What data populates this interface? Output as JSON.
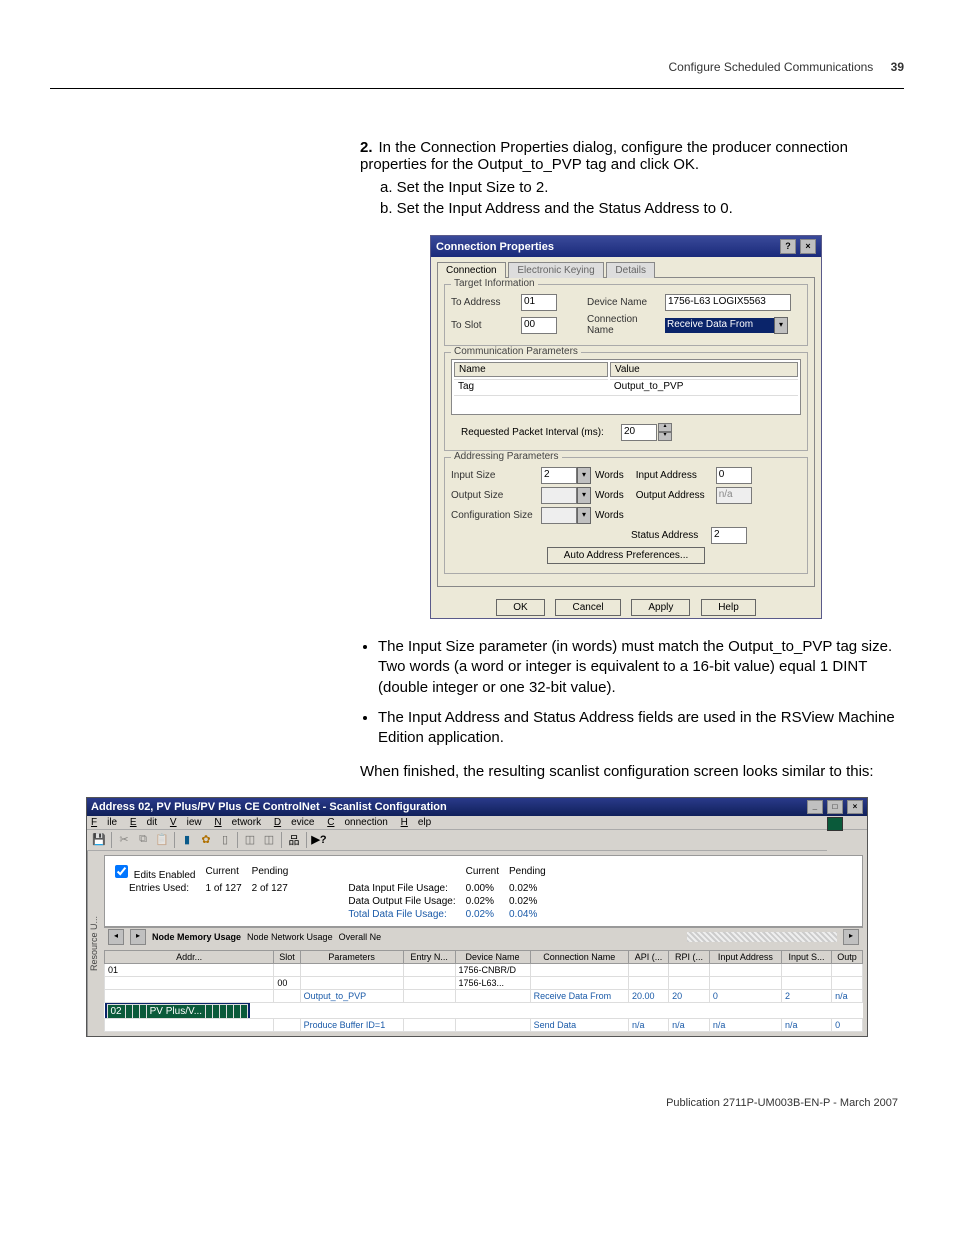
{
  "header": {
    "section": "Configure Scheduled Communications",
    "page": "39"
  },
  "step": {
    "num": "2.",
    "text": "In the Connection Properties dialog, configure the producer connection properties for the Output_to_PVP tag and click OK.",
    "a": "a. Set the Input Size to 2.",
    "b": "b. Set the Input Address and the Status Address to 0."
  },
  "dialog": {
    "title": "Connection Properties",
    "tabs": {
      "t1": "Connection",
      "t2": "Electronic Keying",
      "t3": "Details"
    },
    "group_target": "Target Information",
    "to_addr_lbl": "To Address",
    "to_addr": "01",
    "to_slot_lbl": "To Slot",
    "to_slot": "00",
    "dev_lbl": "Device Name",
    "dev": "1756-L63 LOGIX5563",
    "conn_lbl": "Connection Name",
    "conn": "Receive Data From",
    "group_comm": "Communication Parameters",
    "th_name": "Name",
    "th_val": "Value",
    "row_name": "Tag",
    "row_val": "Output_to_PVP",
    "rpi_lbl": "Requested Packet Interval (ms):",
    "rpi": "20",
    "group_addr": "Addressing Parameters",
    "in_size_lbl": "Input Size",
    "in_size": "2",
    "words": "Words",
    "in_addr_lbl": "Input Address",
    "in_addr": "0",
    "out_size_lbl": "Output Size",
    "out_addr_lbl": "Output Address",
    "out_addr": "n/a",
    "cfg_lbl": "Configuration Size",
    "stat_lbl": "Status Address",
    "stat": "2",
    "auto_btn": "Auto Address Preferences...",
    "ok": "OK",
    "cancel": "Cancel",
    "apply": "Apply",
    "help": "Help"
  },
  "bullets": {
    "b1": "The Input Size parameter (in words) must match the Output_to_PVP tag size. Two words (a word or integer is equivalent to a 16-bit value) equal 1 DINT (double integer or one 32-bit value).",
    "b2": "The Input Address and Status Address fields are used in the RSView Machine Edition application."
  },
  "para_after": "When finished, the resulting scanlist configuration screen looks similar to this:",
  "scanlist": {
    "title": "Address 02, PV Plus/PV Plus CE ControlNet - Scanlist Configuration",
    "menu": {
      "file": "File",
      "edit": "Edit",
      "view": "View",
      "network": "Network",
      "device": "Device",
      "connection": "Connection",
      "help": "Help"
    },
    "vtab": "Resource U...",
    "edits_lbl": "Edits Enabled",
    "entries_lbl": "Entries Used:",
    "cur_h": "Current",
    "pend_h": "Pending",
    "entries_cur": "1 of 127",
    "entries_pend": "2 of 127",
    "difu": "Data Input File Usage:",
    "difu_c": "0.00%",
    "difu_p": "0.02%",
    "dofu": "Data Output File Usage:",
    "dofu_c": "0.02%",
    "dofu_p": "0.02%",
    "tdfu": "Total Data File Usage:",
    "tdfu_c": "0.02%",
    "tdfu_p": "0.04%",
    "memtab1": "Node Memory Usage",
    "memtab2": "Node Network Usage",
    "memtab3": "Overall Ne",
    "cols": {
      "addr": "Addr...",
      "slot": "Slot",
      "params": "Parameters",
      "entry": "Entry N...",
      "dev": "Device Name",
      "conn": "Connection Name",
      "api": "API (...",
      "rpi": "RPI (...",
      "iaddr": "Input Address",
      "isize": "Input S...",
      "outp": "Outp"
    },
    "rows": [
      {
        "addr": "01",
        "slot": "",
        "params": "",
        "entry": "",
        "dev": "1756-CNBR/D",
        "conn": "",
        "api": "",
        "rpi": "",
        "iaddr": "",
        "isize": "",
        "outp": ""
      },
      {
        "addr": "",
        "slot": "00",
        "params": "",
        "entry": "",
        "dev": "1756-L63...",
        "conn": "",
        "api": "",
        "rpi": "",
        "iaddr": "",
        "isize": "",
        "outp": ""
      },
      {
        "addr": "",
        "slot": "",
        "params": "Output_to_PVP",
        "entry": "",
        "dev": "",
        "conn": "Receive Data From",
        "api": "20.00",
        "rpi": "20",
        "iaddr": "0",
        "isize": "2",
        "outp": "n/a"
      },
      {
        "addr": "02",
        "slot": "",
        "params": "",
        "entry": "",
        "dev": "PV Plus/V...",
        "conn": "",
        "api": "",
        "rpi": "",
        "iaddr": "",
        "isize": "",
        "outp": "",
        "sel": true
      },
      {
        "addr": "",
        "slot": "",
        "params": "Produce Buffer ID=1",
        "entry": "",
        "dev": "",
        "conn": "Send Data",
        "api": "n/a",
        "rpi": "n/a",
        "iaddr": "n/a",
        "isize": "n/a",
        "outp": "0"
      }
    ]
  },
  "footer": "Publication 2711P-UM003B-EN-P - March 2007"
}
